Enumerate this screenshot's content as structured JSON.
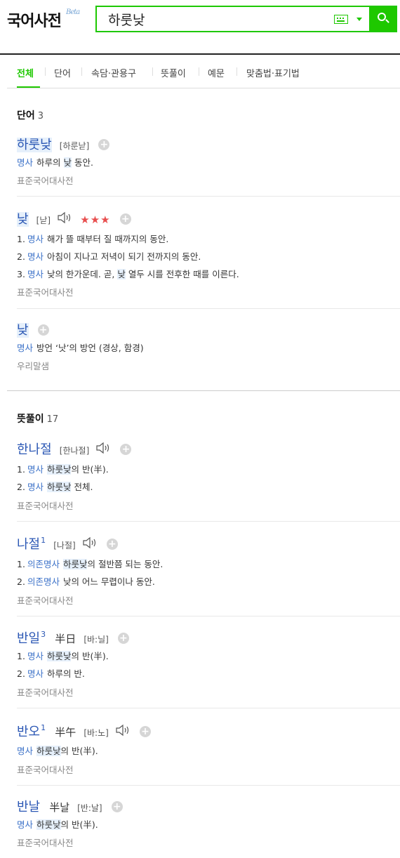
{
  "header": {
    "logo": "국어사전",
    "beta": "Beta",
    "search_value": "하룻낮",
    "keyboard_icon": "keyboard-icon",
    "search_icon": "search-icon"
  },
  "tabs": [
    "전체",
    "단어",
    "속담·관용구",
    "뜻풀이",
    "예문",
    "맞춤법·표기법"
  ],
  "words_section": {
    "title": "단어",
    "count": "3",
    "entries": [
      {
        "headword": "하룻낮",
        "pron": "[하룬낟]",
        "defs": [
          {
            "pos": "명사",
            "pre": "하루의 ",
            "hl": "낮",
            "post": " 동안."
          }
        ],
        "source": "표준국어대사전"
      },
      {
        "headword": "낮",
        "pron": "[낟]",
        "stars": "★★★",
        "defs": [
          {
            "num": "1.",
            "pos": "명사",
            "pre": "해가 뜰 때부터 질 때까지의 동안."
          },
          {
            "num": "2.",
            "pos": "명사",
            "pre": "아침이 지나고 저녁이 되기 전까지의 동안."
          },
          {
            "num": "3.",
            "pos": "명사",
            "pre": "낮의 한가운데. 곧, ",
            "hl": "낮",
            "post": " 열두 시를 전후한 때를 이른다."
          }
        ],
        "source": "표준국어대사전"
      },
      {
        "headword": "낮",
        "defs": [
          {
            "pos": "명사",
            "pre": "방언 ‘낫’의 방언 (경상, 함경)"
          }
        ],
        "source": "우리말샘"
      }
    ]
  },
  "meaning_section": {
    "title": "뜻풀이",
    "count": "17",
    "entries": [
      {
        "headword": "한나절",
        "pron": "[한나절]",
        "defs": [
          {
            "num": "1.",
            "pos": "명사",
            "hl": "하룻낮",
            "post": "의 반(半)."
          },
          {
            "num": "2.",
            "pos": "명사",
            "hl": "하룻낮",
            "post": " 전체."
          }
        ],
        "source": "표준국어대사전"
      },
      {
        "headword": "나절",
        "sup": "1",
        "pron": "[나절]",
        "defs": [
          {
            "num": "1.",
            "pos": "의존명사",
            "hl": "하룻낮",
            "post": "의 절반쯤 되는 동안."
          },
          {
            "num": "2.",
            "pos": "의존명사",
            "pre": "낮의 어느 무렵이나 동안."
          }
        ],
        "source": "표준국어대사전"
      },
      {
        "headword": "반일",
        "sup": "3",
        "hanja": "半日",
        "pron": "[바:닐]",
        "defs": [
          {
            "num": "1.",
            "pos": "명사",
            "hl": "하룻낮",
            "post": "의 반(半)."
          },
          {
            "num": "2.",
            "pos": "명사",
            "pre": "하루의 반."
          }
        ],
        "source": "표준국어대사전"
      },
      {
        "headword": "반오",
        "sup": "1",
        "hanja": "半午",
        "pron": "[바:노]",
        "defs": [
          {
            "pos": "명사",
            "hl": "하룻낮",
            "post": "의 반(半)."
          }
        ],
        "source": "표준국어대사전"
      },
      {
        "headword": "반날",
        "hanja": "半날",
        "pron": "[반:날]",
        "defs": [
          {
            "pos": "명사",
            "hl": "하룻낮",
            "post": "의 반(半)."
          }
        ],
        "source": "표준국어대사전"
      }
    ]
  },
  "colors": {
    "brand_green": "#1ec800",
    "headword_blue": "#2b57b4",
    "pos_blue": "#3b71c8",
    "stars_red": "#e84e4e"
  }
}
